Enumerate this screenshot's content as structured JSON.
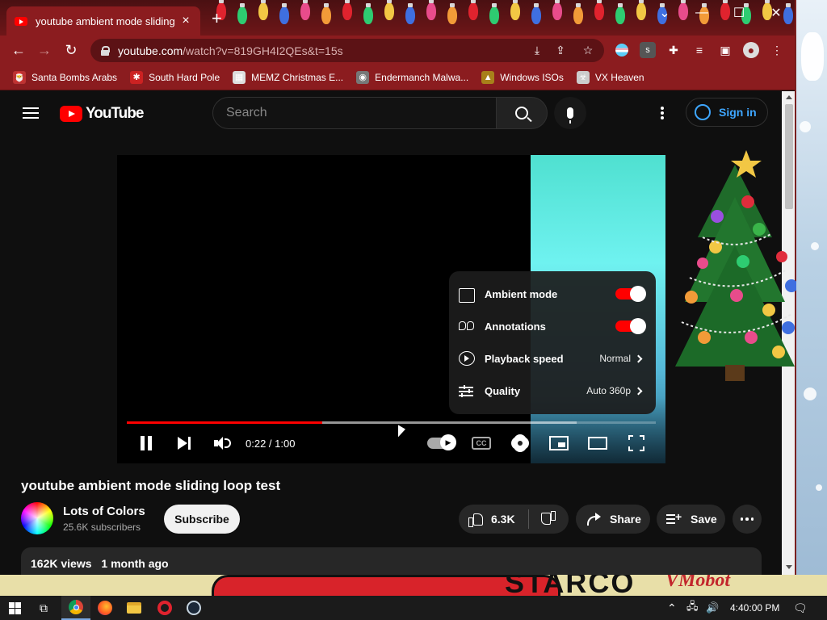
{
  "browser": {
    "tab_title": "youtube ambient mode sliding loop test",
    "tab_close": "×",
    "new_tab": "+",
    "window_controls": [
      "⌄",
      "—",
      "☐",
      "✕"
    ],
    "url_host": "youtube.com",
    "url_path": "/watch?v=819GH4I2QEs&t=15s",
    "nav": {
      "back": "←",
      "forward": "→",
      "reload": "↻"
    },
    "toolbar_icons": [
      "install-icon",
      "share-icon",
      "star-icon",
      "flag-extension-icon",
      "s-extension-icon",
      "puzzle-icon",
      "media-icon",
      "sidepanel-icon",
      "profile-icon",
      "menu-icon"
    ],
    "bookmarks": [
      {
        "label": "Santa Bombs Arabs",
        "icon": "santa-icon",
        "glyph": "🎅"
      },
      {
        "label": "South Hard Pole",
        "icon": "star-bookmark-icon",
        "glyph": "✱"
      },
      {
        "label": "MEMZ Christmas E...",
        "icon": "memz-icon",
        "glyph": "▦"
      },
      {
        "label": "Endermanch Malwa...",
        "icon": "raccoon-icon",
        "glyph": "◉"
      },
      {
        "label": "Windows ISOs",
        "icon": "chest-icon",
        "glyph": "▲"
      },
      {
        "label": "VX Heaven",
        "icon": "biohazard-icon",
        "glyph": "☣"
      }
    ]
  },
  "youtube": {
    "logo_text": "YouTube",
    "search_placeholder": "Search",
    "sign_in": "Sign in",
    "player": {
      "time": "0:22 / 1:00",
      "played_fraction": 0.37,
      "buffered_fraction": 0.85,
      "cc_label": "CC",
      "settings_menu": [
        {
          "label": "Ambient mode",
          "icon": "ambient-icon",
          "kind": "toggle",
          "on": true
        },
        {
          "label": "Annotations",
          "icon": "annotations-icon",
          "kind": "toggle",
          "on": true
        },
        {
          "label": "Playback speed",
          "icon": "speed-icon",
          "kind": "submenu",
          "value": "Normal"
        },
        {
          "label": "Quality",
          "icon": "quality-icon",
          "kind": "submenu",
          "value": "Auto 360p"
        }
      ]
    },
    "video_title": "youtube ambient mode sliding loop test",
    "channel": {
      "name": "Lots of Colors",
      "subscribers": "25.6K subscribers"
    },
    "subscribe": "Subscribe",
    "likes": "6.3K",
    "share": "Share",
    "save": "Save",
    "views": "162K views",
    "date": "1 month ago"
  },
  "desktop": {
    "cartoon_text": "STARCO",
    "watermark": "VMobot"
  },
  "taskbar": {
    "apps": [
      "task-view-icon",
      "chrome-icon",
      "firefox-icon",
      "explorer-icon",
      "opera-icon",
      "steam-icon"
    ],
    "tray_icons": [
      "chevron-up-icon",
      "network-icon",
      "volume-icon"
    ],
    "clock": "4:40:00 PM"
  },
  "colors": {
    "browser_frame": "#8b1c1f",
    "youtube_red": "#ff0000",
    "link_blue": "#3ea6ff",
    "page_bg": "#0f0f0f"
  }
}
